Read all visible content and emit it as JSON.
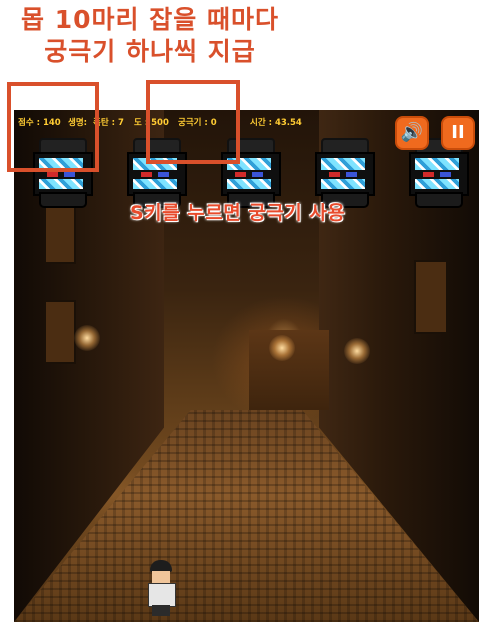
{
  "caption": {
    "line1": "몹 10마리 잡을 때마다",
    "line2": "궁극기 하나씩 지급"
  },
  "hud": {
    "score": "점수 : 140",
    "life": "생명:",
    "bomb": "폭탄 : 7",
    "hp": "도 : 500",
    "ultimate": "궁극기 : 0",
    "time": "시간 : 43.54"
  },
  "buttons": {
    "sound_icon": "speaker-icon",
    "sound_glyph": "🔊",
    "pause_icon": "pause-icon",
    "pause_glyph": "II"
  },
  "hint": "S키를 누르면 궁극기 사용",
  "enemies_count": 5,
  "colors": {
    "caption": "#d9502b",
    "hud_text": "#ffcc33",
    "button": "#f06a1e",
    "hint": "#e84b2c"
  }
}
